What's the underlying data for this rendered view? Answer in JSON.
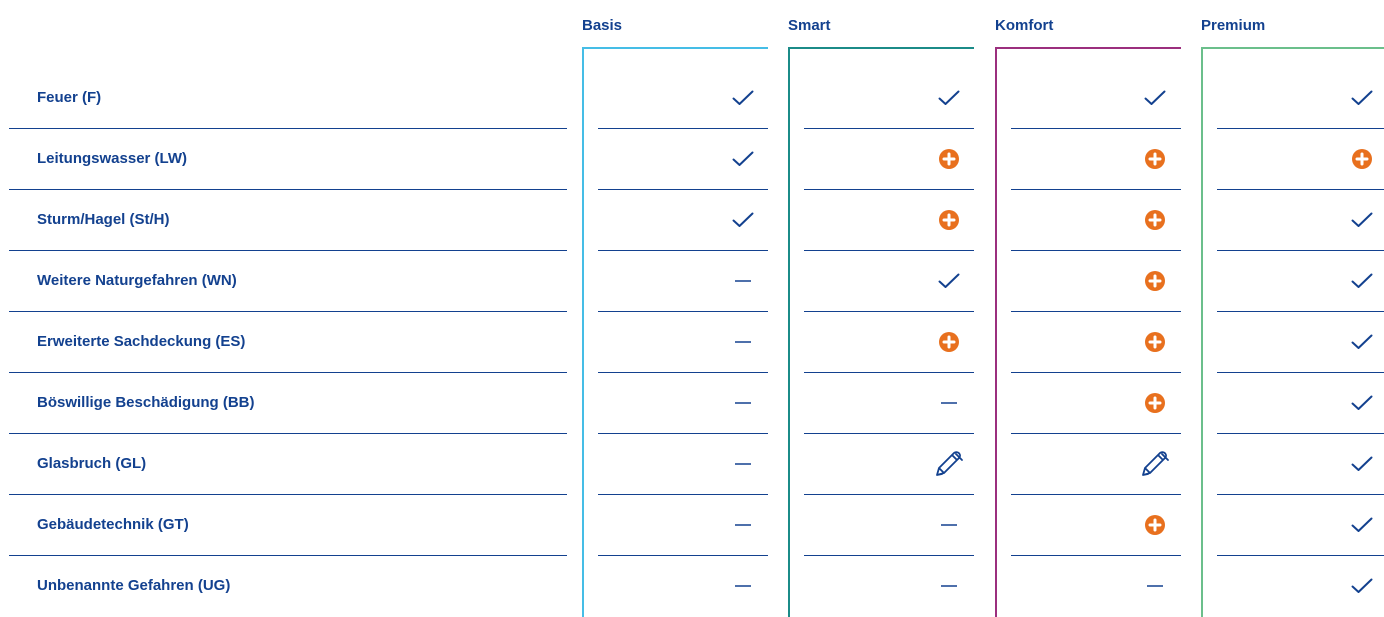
{
  "colors": {
    "text": "#13418f",
    "plus": "#e8701e",
    "basis": "#45bde6",
    "smart": "#1b8b88",
    "komfort": "#9b2f7e",
    "premium": "#6bbf8b"
  },
  "plans": [
    {
      "key": "basis",
      "label": "Basis"
    },
    {
      "key": "smart",
      "label": "Smart"
    },
    {
      "key": "komfort",
      "label": "Komfort"
    },
    {
      "key": "premium",
      "label": "Premium"
    }
  ],
  "legend_icons": {
    "check": "checkmark-icon",
    "plus": "plus-circle-icon",
    "dash": "dash-icon",
    "pen": "pen-icon"
  },
  "rows": [
    {
      "label": "Feuer (F)",
      "cells": [
        "check",
        "check",
        "check",
        "check"
      ]
    },
    {
      "label": "Leitungswasser (LW)",
      "cells": [
        "check",
        "plus",
        "plus",
        "plus"
      ]
    },
    {
      "label": "Sturm/Hagel (St/H)",
      "cells": [
        "check",
        "plus",
        "plus",
        "check"
      ]
    },
    {
      "label": "Weitere Naturgefahren (WN)",
      "cells": [
        "dash",
        "check",
        "plus",
        "check"
      ]
    },
    {
      "label": "Erweiterte Sachdeckung (ES)",
      "cells": [
        "dash",
        "plus",
        "plus",
        "check"
      ]
    },
    {
      "label": "Böswillige Beschädigung (BB)",
      "cells": [
        "dash",
        "dash",
        "plus",
        "check"
      ]
    },
    {
      "label": "Glasbruch (GL)",
      "cells": [
        "dash",
        "pen",
        "pen",
        "check"
      ]
    },
    {
      "label": "Gebäudetechnik (GT)",
      "cells": [
        "dash",
        "dash",
        "plus",
        "check"
      ]
    },
    {
      "label": "Unbenannte Gefahren (UG)",
      "cells": [
        "dash",
        "dash",
        "dash",
        "check"
      ]
    }
  ]
}
